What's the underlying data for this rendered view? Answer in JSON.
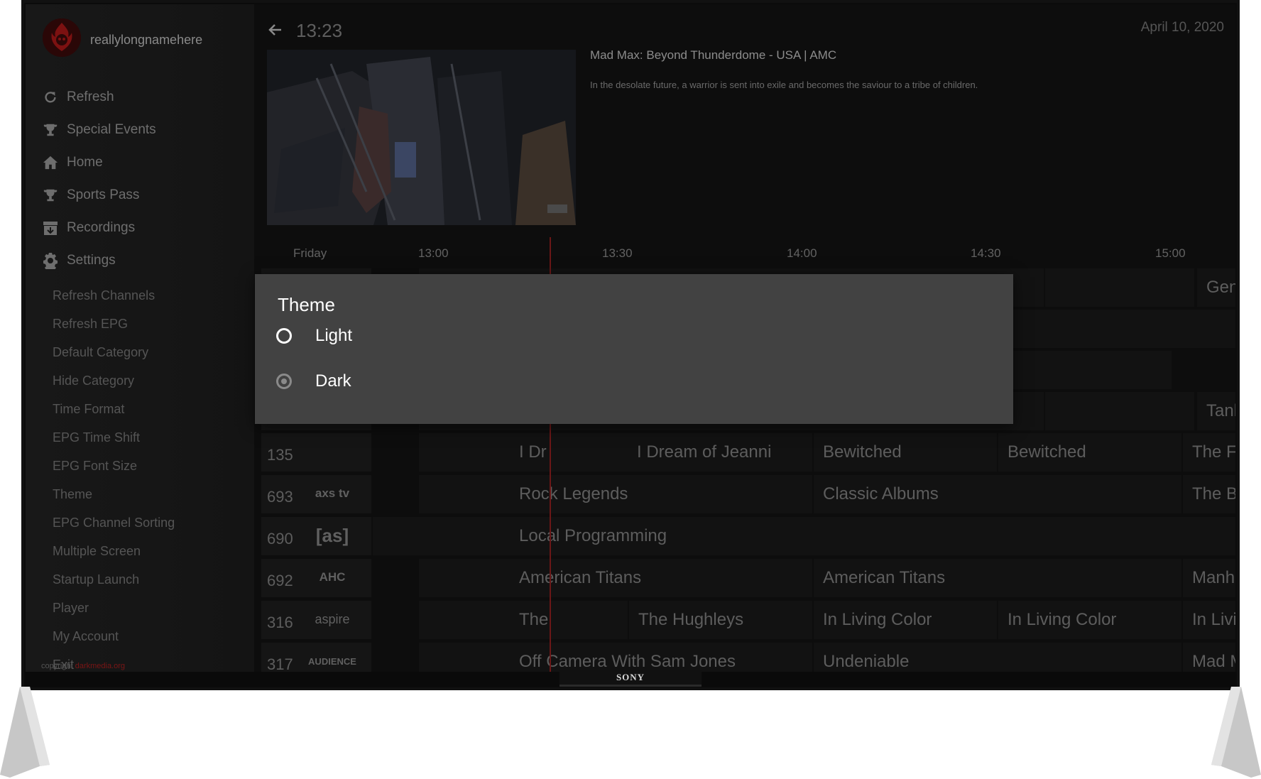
{
  "sidebar": {
    "username": "reallylongnamehere",
    "menu": [
      {
        "label": "Refresh",
        "icon": "refresh-icon"
      },
      {
        "label": "Special Events",
        "icon": "trophy-icon"
      },
      {
        "label": "Home",
        "icon": "home-icon"
      },
      {
        "label": "Sports Pass",
        "icon": "trophy-icon"
      },
      {
        "label": "Recordings",
        "icon": "archive-icon"
      },
      {
        "label": "Settings",
        "icon": "gear-icon"
      }
    ],
    "settings_items": [
      "Refresh Channels",
      "Refresh EPG",
      "Default Category",
      "Hide Category",
      "Time Format",
      "EPG Time Shift",
      "EPG Font Size",
      "Theme",
      "EPG Channel Sorting",
      "Multiple Screen",
      "Startup Launch",
      "Player",
      "My Account",
      "Exit"
    ],
    "copyright_text": "copyright",
    "copyright_link": "darkmedia.org"
  },
  "header": {
    "time": "13:23",
    "date": "April 10, 2020"
  },
  "preview": {
    "title": "Mad Max: Beyond Thunderdome - USA | AMC",
    "description": "In the desolate future, a warrior is sent into exile and becomes the saviour to a tribe of children."
  },
  "timeline": {
    "day": "Friday",
    "times": [
      "13:00",
      "13:30",
      "14:00",
      "14:30",
      "15:00"
    ]
  },
  "grid": {
    "partial_cells": [
      "Genera",
      "Tanked"
    ],
    "rows": [
      {
        "number": "135",
        "logo": "",
        "cells": [
          "I Dr",
          "I Dream of Jeanni",
          "Bewitched",
          "Bewitched",
          "The Fac"
        ]
      },
      {
        "number": "693",
        "logo": "axs tv",
        "cells": [
          "Rock Legends",
          "Classic Albums",
          "The Big"
        ]
      },
      {
        "number": "690",
        "logo": "[as]",
        "cells": [
          "Local Programming"
        ]
      },
      {
        "number": "692",
        "logo": "AHC",
        "cells": [
          "American Titans",
          "American Titans",
          "Manhu"
        ]
      },
      {
        "number": "316",
        "logo": "aspire",
        "cells": [
          "The",
          "The Hughleys",
          "In Living Color",
          "In Living Color",
          "In Living"
        ]
      },
      {
        "number": "317",
        "logo": "AUDIENCE",
        "cells": [
          "Off Camera With Sam Jones",
          "Undeniable",
          "Mad Me"
        ]
      }
    ]
  },
  "dialog": {
    "title": "Theme",
    "options": [
      {
        "label": "Light",
        "selected": false
      },
      {
        "label": "Dark",
        "selected": true
      }
    ]
  },
  "tv": {
    "brand": "SONY"
  },
  "colors": {
    "accent": "#7a1515",
    "dialog_bg": "#424242"
  }
}
